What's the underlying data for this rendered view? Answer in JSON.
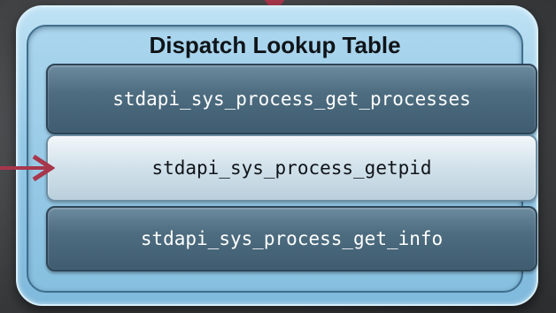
{
  "table": {
    "title": "Dispatch Lookup Table",
    "entries": [
      {
        "label": "stdapi_sys_process_get_processes",
        "highlighted": false
      },
      {
        "label": "stdapi_sys_process_getpid",
        "highlighted": true
      },
      {
        "label": "stdapi_sys_process_get_info",
        "highlighted": false
      }
    ]
  },
  "colors": {
    "arrow": "#a8364b",
    "outer_frame": "#94c8e6",
    "entry_dark": "#4e6d81",
    "entry_highlight": "#d4e3ec"
  },
  "icons": {
    "top_arrow": "down-arrow-icon",
    "side_arrow": "right-arrow-icon"
  }
}
